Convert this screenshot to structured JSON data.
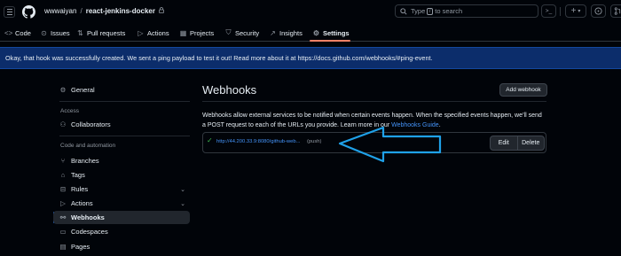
{
  "header": {
    "owner": "wwwaiyan",
    "separator": "/",
    "repo": "react-jenkins-docker",
    "search_prefix": "Type",
    "search_kbd": "/",
    "search_suffix": "to search",
    "terminal_label": ">_",
    "plus_label": "+",
    "plus_caret": "▾"
  },
  "tabs": [
    {
      "label": "Code",
      "icon": "code-icon",
      "glyph": "<>"
    },
    {
      "label": "Issues",
      "icon": "issue-icon",
      "glyph": "⊙"
    },
    {
      "label": "Pull requests",
      "icon": "pull-request-icon",
      "glyph": "⇅"
    },
    {
      "label": "Actions",
      "icon": "play-icon",
      "glyph": "▷"
    },
    {
      "label": "Projects",
      "icon": "table-icon",
      "glyph": "▦"
    },
    {
      "label": "Security",
      "icon": "shield-icon",
      "glyph": "⛉"
    },
    {
      "label": "Insights",
      "icon": "graph-icon",
      "glyph": "↗"
    },
    {
      "label": "Settings",
      "icon": "gear-icon",
      "glyph": "⚙"
    }
  ],
  "flash": {
    "message": "Okay, that hook was successfully created. We sent a ping payload to test it out! Read more about it at https://docs.github.com/webhooks/#ping-event."
  },
  "sidebar": {
    "general": "General",
    "access_heading": "Access",
    "collaborators": "Collaborators",
    "code_heading": "Code and automation",
    "branches": "Branches",
    "tags": "Tags",
    "rules": "Rules",
    "actions": "Actions",
    "webhooks": "Webhooks",
    "codespaces": "Codespaces",
    "pages": "Pages"
  },
  "main": {
    "title": "Webhooks",
    "add_button": "Add webhook",
    "description_before": "Webhooks allow external services to be notified when certain events happen. When the specified events happen, we’ll send a POST request to each of the URLs you provide. Learn more in our ",
    "description_link": "Webhooks Guide",
    "description_after": ".",
    "hook": {
      "url": "http://44.200.33.9:8080/github-web...",
      "event": "(push)",
      "edit": "Edit",
      "delete": "Delete"
    }
  },
  "colors": {
    "accent": "#2f81f7",
    "annotation_arrow": "#1fa1e8",
    "success": "#3fb950"
  }
}
